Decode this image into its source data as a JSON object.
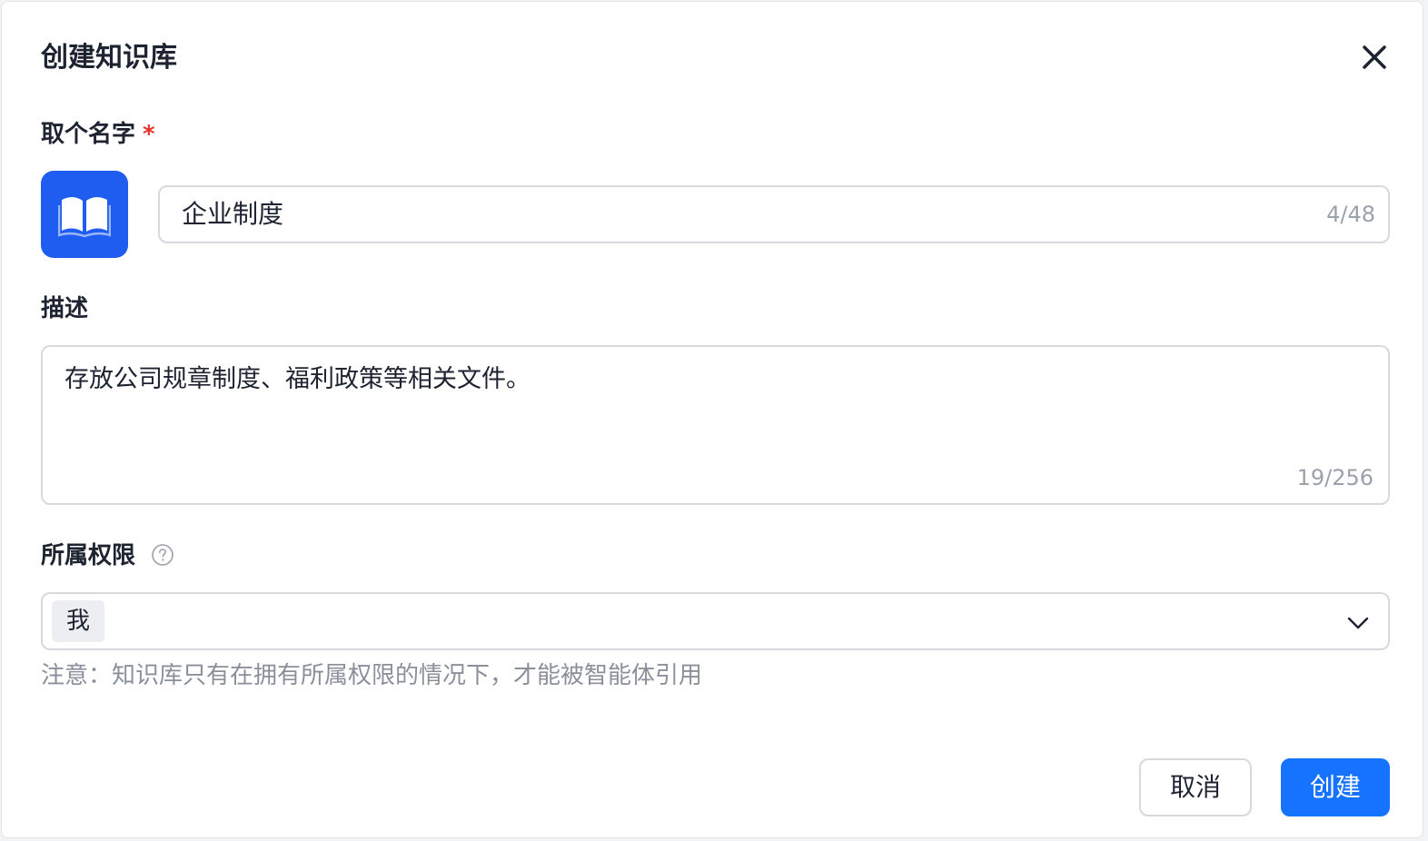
{
  "dialog": {
    "title": "创建知识库",
    "close_icon": "close-icon"
  },
  "name_field": {
    "label": "取个名字",
    "required_mark": "*",
    "avatar_icon": "book-icon",
    "avatar_color": "#1f5cf0",
    "value": "企业制度",
    "counter": "4/48"
  },
  "description_field": {
    "label": "描述",
    "value": "存放公司规章制度、福利政策等相关文件。",
    "counter": "19/256"
  },
  "permission_field": {
    "label": "所属权限",
    "help_icon": "question-circle-icon",
    "selected_tag": "我",
    "dropdown_icon": "chevron-down-icon",
    "note": "注意：知识库只有在拥有所属权限的情况下，才能被智能体引用"
  },
  "footer": {
    "cancel_label": "取消",
    "create_label": "创建",
    "primary_color": "#1573ff"
  }
}
